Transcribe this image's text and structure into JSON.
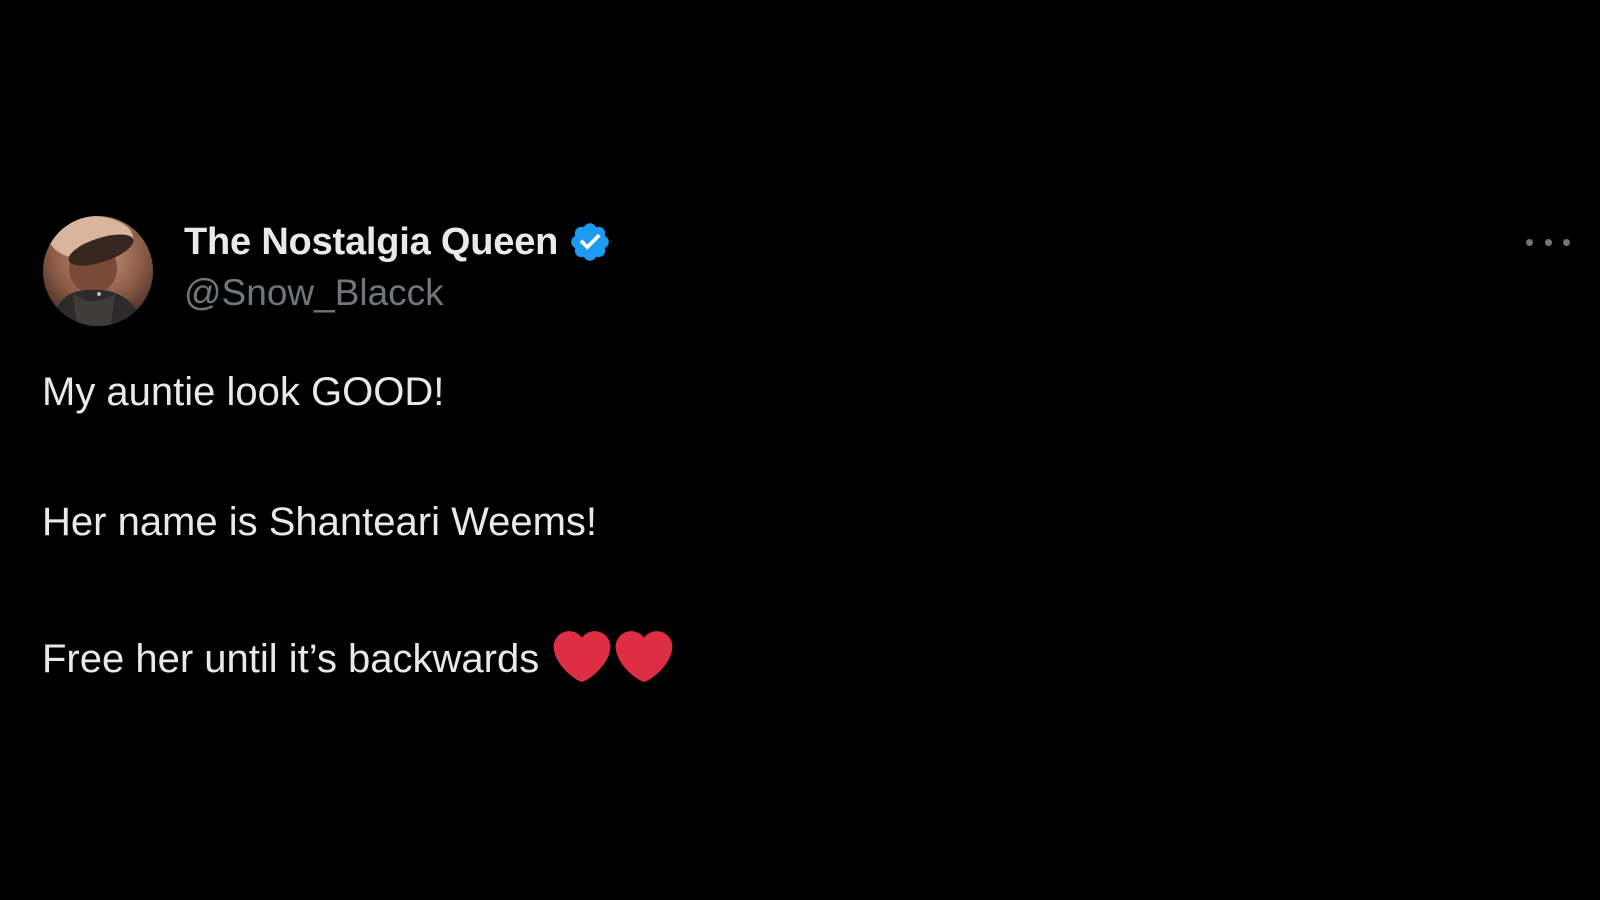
{
  "tweet": {
    "display_name": "The Nostalgia Queen",
    "handle": "@Snow_Blacck",
    "verified": true,
    "verified_color": "#1d9bf0",
    "more_icon": "more-horizontal-icon",
    "lines": [
      "My auntie look GOOD!",
      "Her name is Shanteari Weems!",
      "Free her until it’s backwards"
    ],
    "trailing_emoji": [
      "red-heart-icon",
      "red-heart-icon"
    ],
    "heart_color": "#dd2e44"
  },
  "colors": {
    "background": "#000000",
    "primary_text": "#e7e9ea",
    "secondary_text": "#71767b"
  }
}
